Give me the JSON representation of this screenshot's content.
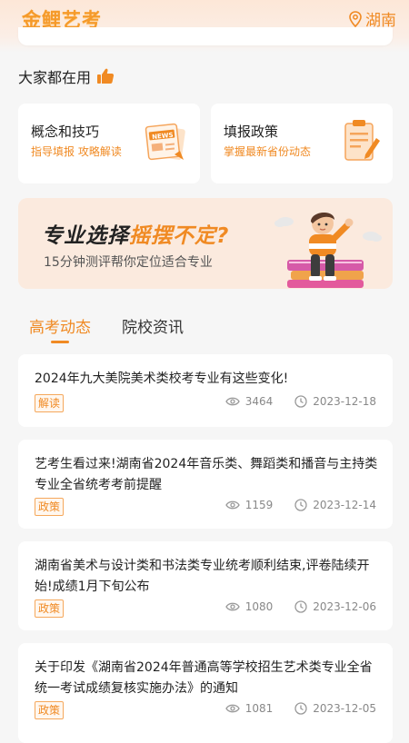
{
  "header": {
    "logo": "金鲤艺考",
    "location": "湖南"
  },
  "section": {
    "title": "大家都在用"
  },
  "cards": [
    {
      "title": "概念和技巧",
      "subtitle": "指导填报 攻略解读",
      "icon": "news-icon"
    },
    {
      "title": "填报政策",
      "subtitle": "掌握最新省份动态",
      "icon": "clipboard-icon"
    }
  ],
  "banner": {
    "title_part1": "专业选择",
    "title_part2": "摇摆不定?",
    "subtitle": "15分钟测评帮你定位适合专业"
  },
  "tabs": [
    {
      "label": "高考动态",
      "active": true
    },
    {
      "label": "院校资讯",
      "active": false
    }
  ],
  "news": [
    {
      "title": "2024年九大美院美术类校考专业有这些变化!",
      "tag": "解读",
      "views": "3464",
      "date": "2023-12-18"
    },
    {
      "title": "艺考生看过来!湖南省2024年音乐类、舞蹈类和播音与主持类专业全省统考考前提醒",
      "tag": "政策",
      "views": "1159",
      "date": "2023-12-14"
    },
    {
      "title": "湖南省美术与设计类和书法类专业统考顺利结束,评卷陆续开始!成绩1月下旬公布",
      "tag": "政策",
      "views": "1080",
      "date": "2023-12-06"
    },
    {
      "title": "关于印发《湖南省2024年普通高等学校招生艺术类专业全省统一考试成绩复核实施办法》的通知",
      "tag": "政策",
      "views": "1081",
      "date": "2023-12-05"
    }
  ],
  "colors": {
    "accent": "#f08a23",
    "background": "#f6f6f6",
    "card": "#ffffff",
    "banner": "#fbeade"
  }
}
